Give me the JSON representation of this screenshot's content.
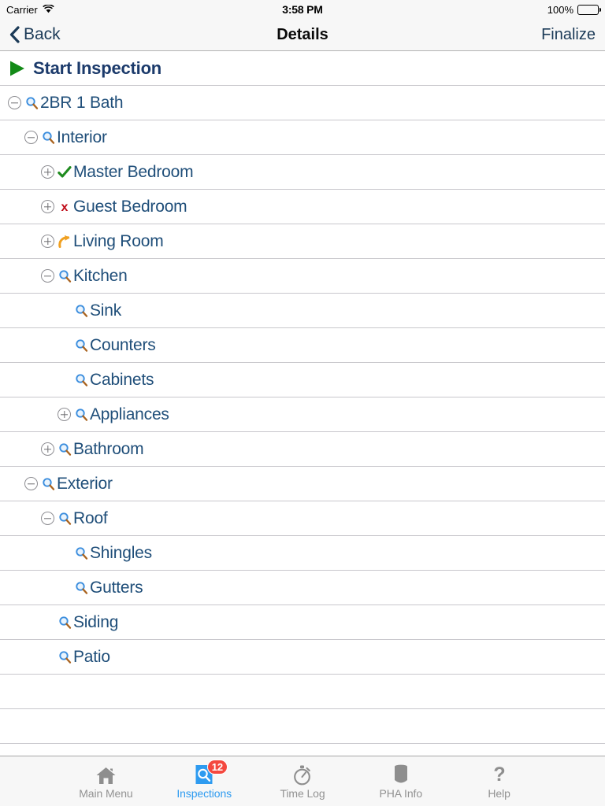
{
  "status_bar": {
    "carrier": "Carrier",
    "wifi_icon": "wifi-icon",
    "time": "3:58 PM",
    "battery_percent": "100%",
    "battery_icon": "battery-full-icon"
  },
  "nav_bar": {
    "back_label": "Back",
    "back_icon": "chevron-left-icon",
    "title": "Details",
    "right_action_label": "Finalize"
  },
  "colors": {
    "link_blue": "#1f4e79",
    "nav_tint": "#1b3a57",
    "accent_active": "#2e9bf0",
    "pass_green": "#1f8b1f",
    "fail_red": "#bf0a17",
    "followup_orange": "#f0a020",
    "badge_red": "#f4483f",
    "separator": "#c8c7cc"
  },
  "tree": {
    "start_row": {
      "label": "Start Inspection",
      "icon": "play-icon"
    },
    "rows": [
      {
        "label": "2BR 1 Bath",
        "level": 0,
        "toggle": "minus",
        "icon": "magnifier-icon"
      },
      {
        "label": "Interior",
        "level": 1,
        "toggle": "minus",
        "icon": "magnifier-icon"
      },
      {
        "label": "Master Bedroom",
        "level": 2,
        "toggle": "plus",
        "icon": "check-icon"
      },
      {
        "label": "Guest Bedroom",
        "level": 2,
        "toggle": "plus",
        "icon": "x-icon"
      },
      {
        "label": "Living Room",
        "level": 2,
        "toggle": "plus",
        "icon": "followup-arrow-icon"
      },
      {
        "label": "Kitchen",
        "level": 2,
        "toggle": "minus",
        "icon": "magnifier-icon"
      },
      {
        "label": "Sink",
        "level": 3,
        "toggle": "none",
        "icon": "magnifier-icon"
      },
      {
        "label": "Counters",
        "level": 3,
        "toggle": "none",
        "icon": "magnifier-icon"
      },
      {
        "label": "Cabinets",
        "level": 3,
        "toggle": "none",
        "icon": "magnifier-icon"
      },
      {
        "label": "Appliances",
        "level": 3,
        "toggle": "plus",
        "icon": "magnifier-icon"
      },
      {
        "label": "Bathroom",
        "level": 2,
        "toggle": "plus",
        "icon": "magnifier-icon"
      },
      {
        "label": "Exterior",
        "level": 1,
        "toggle": "minus",
        "icon": "magnifier-icon"
      },
      {
        "label": "Roof",
        "level": 2,
        "toggle": "minus",
        "icon": "magnifier-icon"
      },
      {
        "label": "Shingles",
        "level": 3,
        "toggle": "none",
        "icon": "magnifier-icon"
      },
      {
        "label": "Gutters",
        "level": 3,
        "toggle": "none",
        "icon": "magnifier-icon"
      },
      {
        "label": "Siding",
        "level": 2,
        "toggle": "none",
        "icon": "magnifier-icon"
      },
      {
        "label": "Patio",
        "level": 2,
        "toggle": "none",
        "icon": "magnifier-icon"
      }
    ],
    "empty_rows": 2
  },
  "tab_bar": {
    "tabs": [
      {
        "label": "Main Menu",
        "icon": "home-icon",
        "active": false,
        "badge": null
      },
      {
        "label": "Inspections",
        "icon": "document-search-icon",
        "active": true,
        "badge": "12"
      },
      {
        "label": "Time Log",
        "icon": "stopwatch-icon",
        "active": false,
        "badge": null
      },
      {
        "label": "PHA Info",
        "icon": "database-icon",
        "active": false,
        "badge": null
      },
      {
        "label": "Help",
        "icon": "question-mark-icon",
        "active": false,
        "badge": null
      }
    ]
  }
}
